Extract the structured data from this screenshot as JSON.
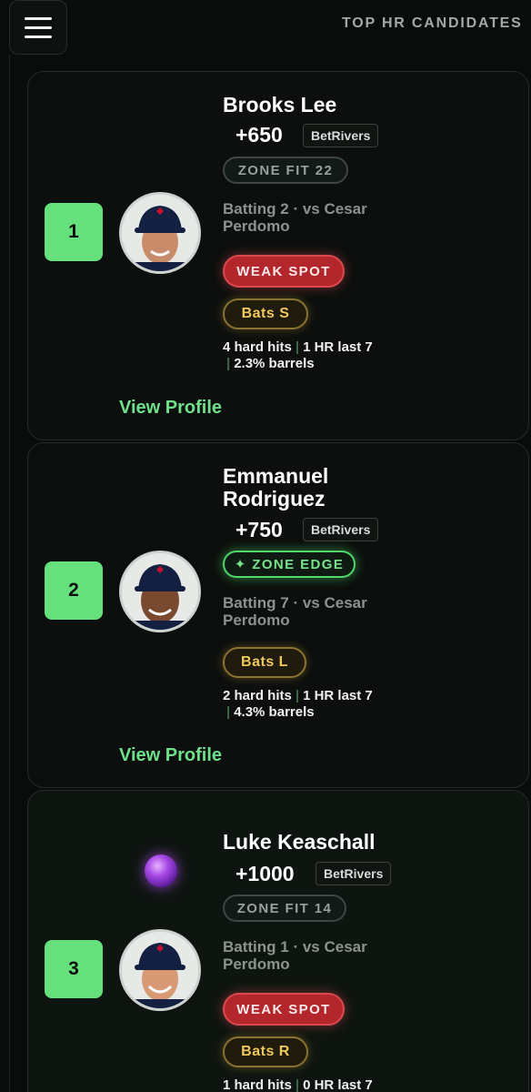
{
  "header": {
    "title": "TOP HR CANDIDATES"
  },
  "candidates": [
    {
      "rank": "1",
      "name": "Brooks Lee",
      "odds": "+650",
      "book": "BetRivers",
      "zone": "ZONE FIT 22",
      "batting": "Batting 2 · vs Cesar Perdomo",
      "badge": "WEAK SPOT",
      "bats": "Bats S",
      "hard_hits": "4 hard hits",
      "hr_last": "1 HR last 7",
      "barrels": "2.3% barrels",
      "link": "View Profile"
    },
    {
      "rank": "2",
      "name": "Emmanuel Rodriguez",
      "odds": "+750",
      "book": "BetRivers",
      "zone": "✦ ZONE EDGE",
      "batting": "Batting 7 · vs Cesar Perdomo",
      "bats": "Bats L",
      "hard_hits": "2 hard hits",
      "hr_last": "1 HR last 7",
      "barrels": "4.3% barrels",
      "link": "View Profile"
    },
    {
      "rank": "3",
      "name": "Luke Keaschall",
      "odds": "+1000",
      "book": "BetRivers",
      "zone": "ZONE FIT 14",
      "batting": "Batting 1 · vs Cesar Perdomo",
      "badge": "WEAK SPOT",
      "bats": "Bats R",
      "hard_hits": "1 hard hits",
      "hr_last": "0 HR last 7"
    }
  ],
  "icons": {
    "menu": "hamburger-menu-icon",
    "orb": "crystal-ball-icon"
  },
  "colors": {
    "rank_badge": "#66e07d",
    "link": "#6fe08a",
    "weak_spot": "#b3262b",
    "zone_edge": "#51d86c",
    "bats": "#f1c85a"
  }
}
